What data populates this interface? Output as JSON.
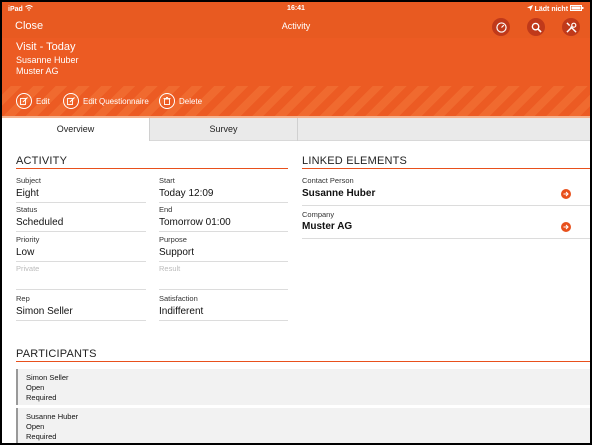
{
  "status_bar": {
    "device": "iPad",
    "wifi_icon": "wifi-icon",
    "time": "16:41",
    "location_icon": "location-arrow-icon",
    "charging_text": "Lädt nicht",
    "battery_icon": "battery-icon"
  },
  "nav": {
    "close_label": "Close",
    "title": "Activity"
  },
  "header": {
    "title": "Visit - Today",
    "contact": "Susanne Huber",
    "company": "Muster AG"
  },
  "actions": {
    "edit_label": "Edit",
    "edit_questionnaire_label": "Edit Questionnaire",
    "delete_label": "Delete"
  },
  "tabs": [
    {
      "label": "Overview",
      "active": true
    },
    {
      "label": "Survey",
      "active": false
    }
  ],
  "activity": {
    "section_title": "ACTIVITY",
    "subject_label": "Subject",
    "subject_value": "Eight",
    "start_label": "Start",
    "start_value": "Today 12:09",
    "status_label": "Status",
    "status_value": "Scheduled",
    "end_label": "End",
    "end_value": "Tomorrow 01:00",
    "priority_label": "Priority",
    "priority_value": "Low",
    "purpose_label": "Purpose",
    "purpose_value": "Support",
    "private_label": "Private",
    "result_label": "Result",
    "rep_label": "Rep",
    "rep_value": "Simon Seller",
    "satisfaction_label": "Satisfaction",
    "satisfaction_value": "Indifferent"
  },
  "linked": {
    "section_title": "LINKED ELEMENTS",
    "contact_label": "Contact Person",
    "contact_value": "Susanne Huber",
    "company_label": "Company",
    "company_value": "Muster AG"
  },
  "participants": {
    "section_title": "PARTICIPANTS",
    "items": [
      {
        "name": "Simon Seller",
        "status": "Open",
        "role": "Required"
      },
      {
        "name": "Susanne Huber",
        "status": "Open",
        "role": "Required"
      }
    ]
  },
  "colors": {
    "accent": "#e8501c",
    "header_bg": "#ec5b23",
    "tab_bg": "#eaeaea"
  }
}
